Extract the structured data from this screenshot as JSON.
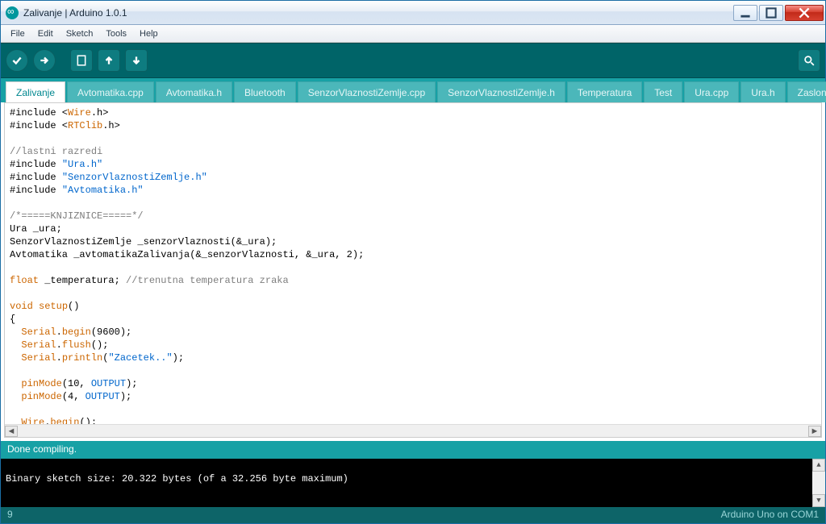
{
  "window": {
    "title": "Zalivanje | Arduino 1.0.1"
  },
  "menu": {
    "file": "File",
    "edit": "Edit",
    "sketch": "Sketch",
    "tools": "Tools",
    "help": "Help"
  },
  "tabs": [
    "Zalivanje",
    "Avtomatika.cpp",
    "Avtomatika.h",
    "Bluetooth",
    "SenzorVlaznostiZemlje.cpp",
    "SenzorVlaznostiZemlje.h",
    "Temperatura",
    "Test",
    "Ura.cpp",
    "Ura.h",
    "Zaslon"
  ],
  "active_tab": 0,
  "code": {
    "l1a": "#include <",
    "l1b": "Wire",
    "l1c": ".h>",
    "l2a": "#include <",
    "l2b": "RTClib",
    "l2c": ".h>",
    "l4": "//lastni razredi",
    "l5a": "#include ",
    "l5b": "\"Ura.h\"",
    "l6a": "#include ",
    "l6b": "\"SenzorVlaznostiZemlje.h\"",
    "l7a": "#include ",
    "l7b": "\"Avtomatika.h\"",
    "l9": "/*=====KNJIZNICE=====*/",
    "l10": "Ura _ura;",
    "l11": "SenzorVlaznostiZemlje _senzorVlaznosti(&_ura);",
    "l12": "Avtomatika _avtomatikaZalivanja(&_senzorVlaznosti, &_ura, 2);",
    "l14a": "float",
    "l14b": " _temperatura; ",
    "l14c": "//trenutna temperatura zraka",
    "l16a": "void",
    "l16b": "setup",
    "l16c": "()",
    "l17": "{",
    "l18a": "Serial",
    "l18b": ".",
    "l18c": "begin",
    "l18d": "(9600);",
    "l19a": "Serial",
    "l19b": ".",
    "l19c": "flush",
    "l19d": "();",
    "l20a": "Serial",
    "l20b": ".",
    "l20c": "println",
    "l20d": "(",
    "l20e": "\"Zacetek..\"",
    "l20f": ");",
    "l22a": "pinMode",
    "l22b": "(10, ",
    "l22c": "OUTPUT",
    "l22d": ");",
    "l23a": "pinMode",
    "l23b": "(4, ",
    "l23c": "OUTPUT",
    "l23d": ");",
    "l25a": "Wire",
    "l25b": ".",
    "l25c": "begin",
    "l25d": "();"
  },
  "status": {
    "compile": "Done compiling."
  },
  "console": {
    "line1": "Binary sketch size: 20.322 bytes (of a 32.256 byte maximum)"
  },
  "footer": {
    "left": "9",
    "right": "Arduino Uno on COM1"
  }
}
